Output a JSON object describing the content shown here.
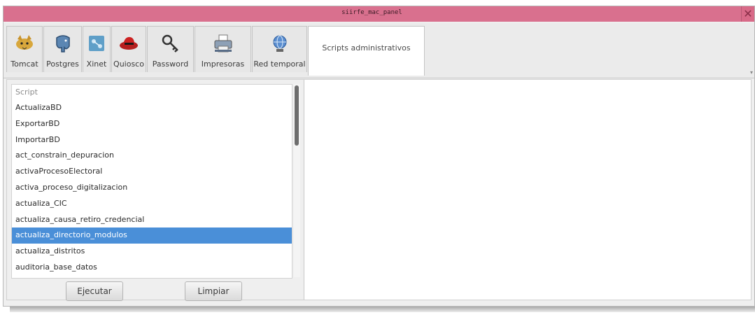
{
  "window": {
    "title": "siirfe_mac_panel",
    "close_symbol": "✕"
  },
  "tabs": [
    {
      "label": "Tomcat",
      "icon": "tomcat-cat-icon"
    },
    {
      "label": "Postgres",
      "icon": "postgres-elephant-icon"
    },
    {
      "label": "Xinet",
      "icon": "xinet-network-icon"
    },
    {
      "label": "Quiosco",
      "icon": "quiosco-redhat-icon"
    },
    {
      "label": "Password",
      "icon": "key-icon"
    },
    {
      "label": "Impresoras",
      "icon": "printer-icon"
    },
    {
      "label": "Red temporal",
      "icon": "network-globe-icon"
    },
    {
      "label": "Scripts administrativos",
      "icon": "",
      "active": true
    }
  ],
  "script_list": {
    "header": "Script",
    "items": [
      "ActualizaBD",
      "ExportarBD",
      "ImportarBD",
      "act_constrain_depuracion",
      "activaProcesoElectoral",
      "activa_proceso_digitalizacion",
      "actualiza_CIC",
      "actualiza_causa_retiro_credencial",
      "actualiza_directorio_modulos",
      "actualiza_distritos",
      "auditoria_base_datos"
    ],
    "selected": "actualiza_directorio_modulos"
  },
  "buttons": {
    "execute": "Ejecutar",
    "clear": "Limpiar"
  },
  "colors": {
    "titlebar": "#d9708e",
    "selection": "#4a8fd8"
  }
}
